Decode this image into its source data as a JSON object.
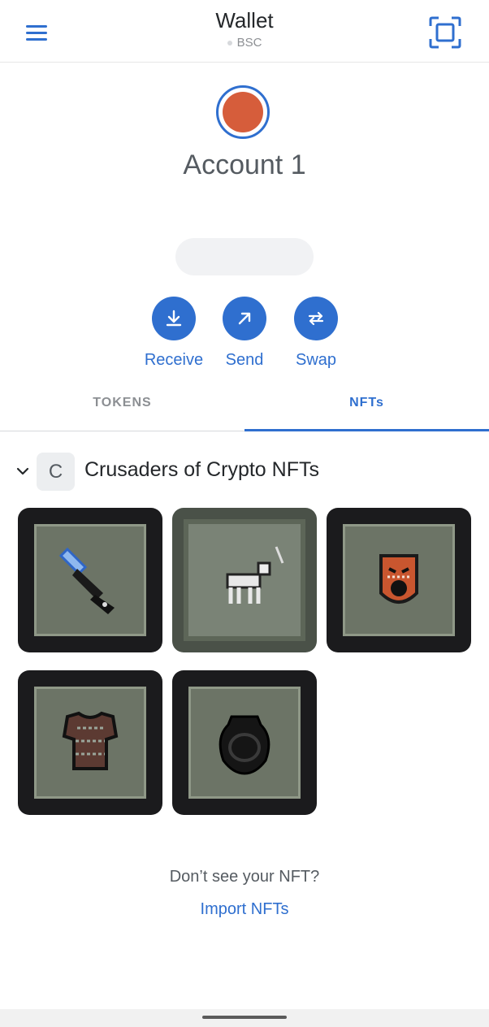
{
  "header": {
    "title": "Wallet",
    "network": "BSC",
    "menu_icon": "hamburger-menu-icon",
    "scan_icon": "qr-scan-icon"
  },
  "account": {
    "name": "Account 1",
    "avatar_color": "#d65d3b",
    "ring_color": "#2f6fcf"
  },
  "actions": [
    {
      "label": "Receive",
      "icon": "receive-icon"
    },
    {
      "label": "Send",
      "icon": "send-arrow-icon"
    },
    {
      "label": "Swap",
      "icon": "swap-icon"
    }
  ],
  "tabs": {
    "tokens": "TOKENS",
    "nfts": "NFTs",
    "active": "NFTs"
  },
  "collection": {
    "badge_letter": "C",
    "title": "Crusaders of Crypto NFTs",
    "items": [
      {
        "icon": "sword-nft-icon"
      },
      {
        "icon": "dog-skeleton-nft-icon"
      },
      {
        "icon": "demon-shield-nft-icon"
      },
      {
        "icon": "armor-nft-icon"
      },
      {
        "icon": "black-pot-nft-icon"
      }
    ]
  },
  "footer": {
    "dont_see": "Don’t see your NFT?",
    "import_link": "Import NFTs"
  },
  "colors": {
    "accent": "#2f6fcf",
    "text": "#24272a",
    "muted": "#8c8f93"
  }
}
